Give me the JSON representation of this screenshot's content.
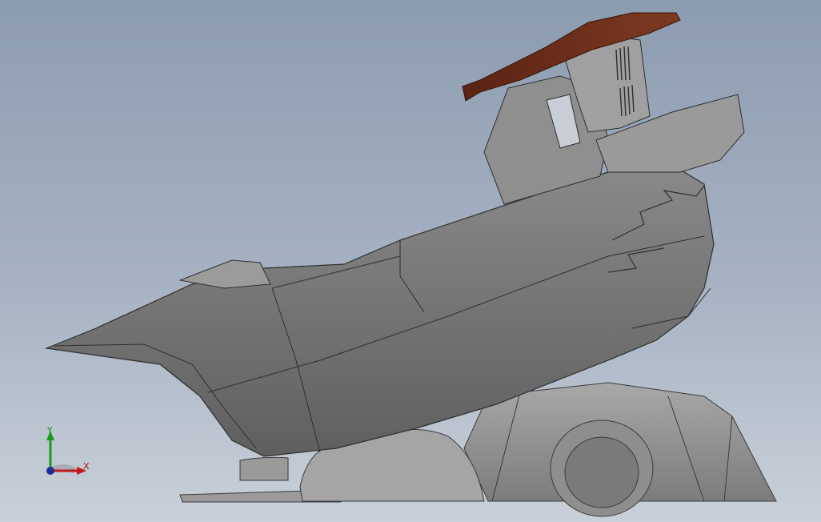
{
  "viewport": {
    "background_top": "#8c9cb0",
    "background_bottom": "#c9d0d9"
  },
  "model": {
    "body_color": "#7a7a7a",
    "roof_color": "#6b2e1c"
  },
  "triad": {
    "x_label": "X",
    "y_label": "Y",
    "x_color": "#c01818",
    "y_color": "#1a9a1a",
    "origin_color": "#1f2a9a"
  }
}
